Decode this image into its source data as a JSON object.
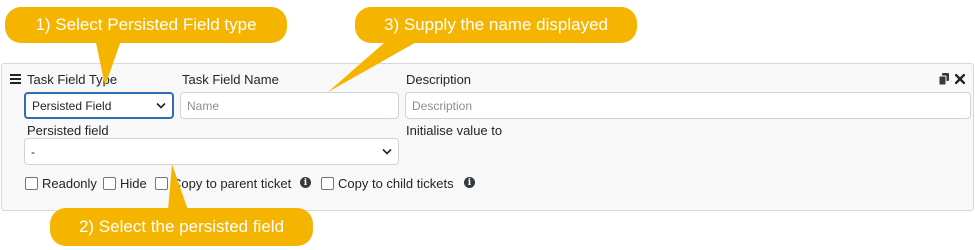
{
  "callouts": {
    "step1": "1) Select Persisted Field type",
    "step2": "2) Select the persisted field",
    "step3": "3) Supply the name displayed"
  },
  "form": {
    "type_label": "Task Field Type",
    "type_value": "Persisted Field",
    "name_label": "Task Field Name",
    "name_placeholder": "Name",
    "description_label": "Description",
    "description_placeholder": "Description",
    "persisted_label": "Persisted field",
    "persisted_value": "-",
    "initialise_label": "Initialise value to"
  },
  "checkboxes": {
    "readonly": "Readonly",
    "hide": "Hide",
    "copy_parent": "Copy to parent ticket",
    "copy_child": "Copy to child tickets"
  },
  "icons": {
    "drag": "drag-handle-icon",
    "copy": "copy-icon",
    "close": "close-icon",
    "info": "info-icon"
  },
  "colors": {
    "callout": "#f5b400",
    "focus": "#2f6db5"
  }
}
